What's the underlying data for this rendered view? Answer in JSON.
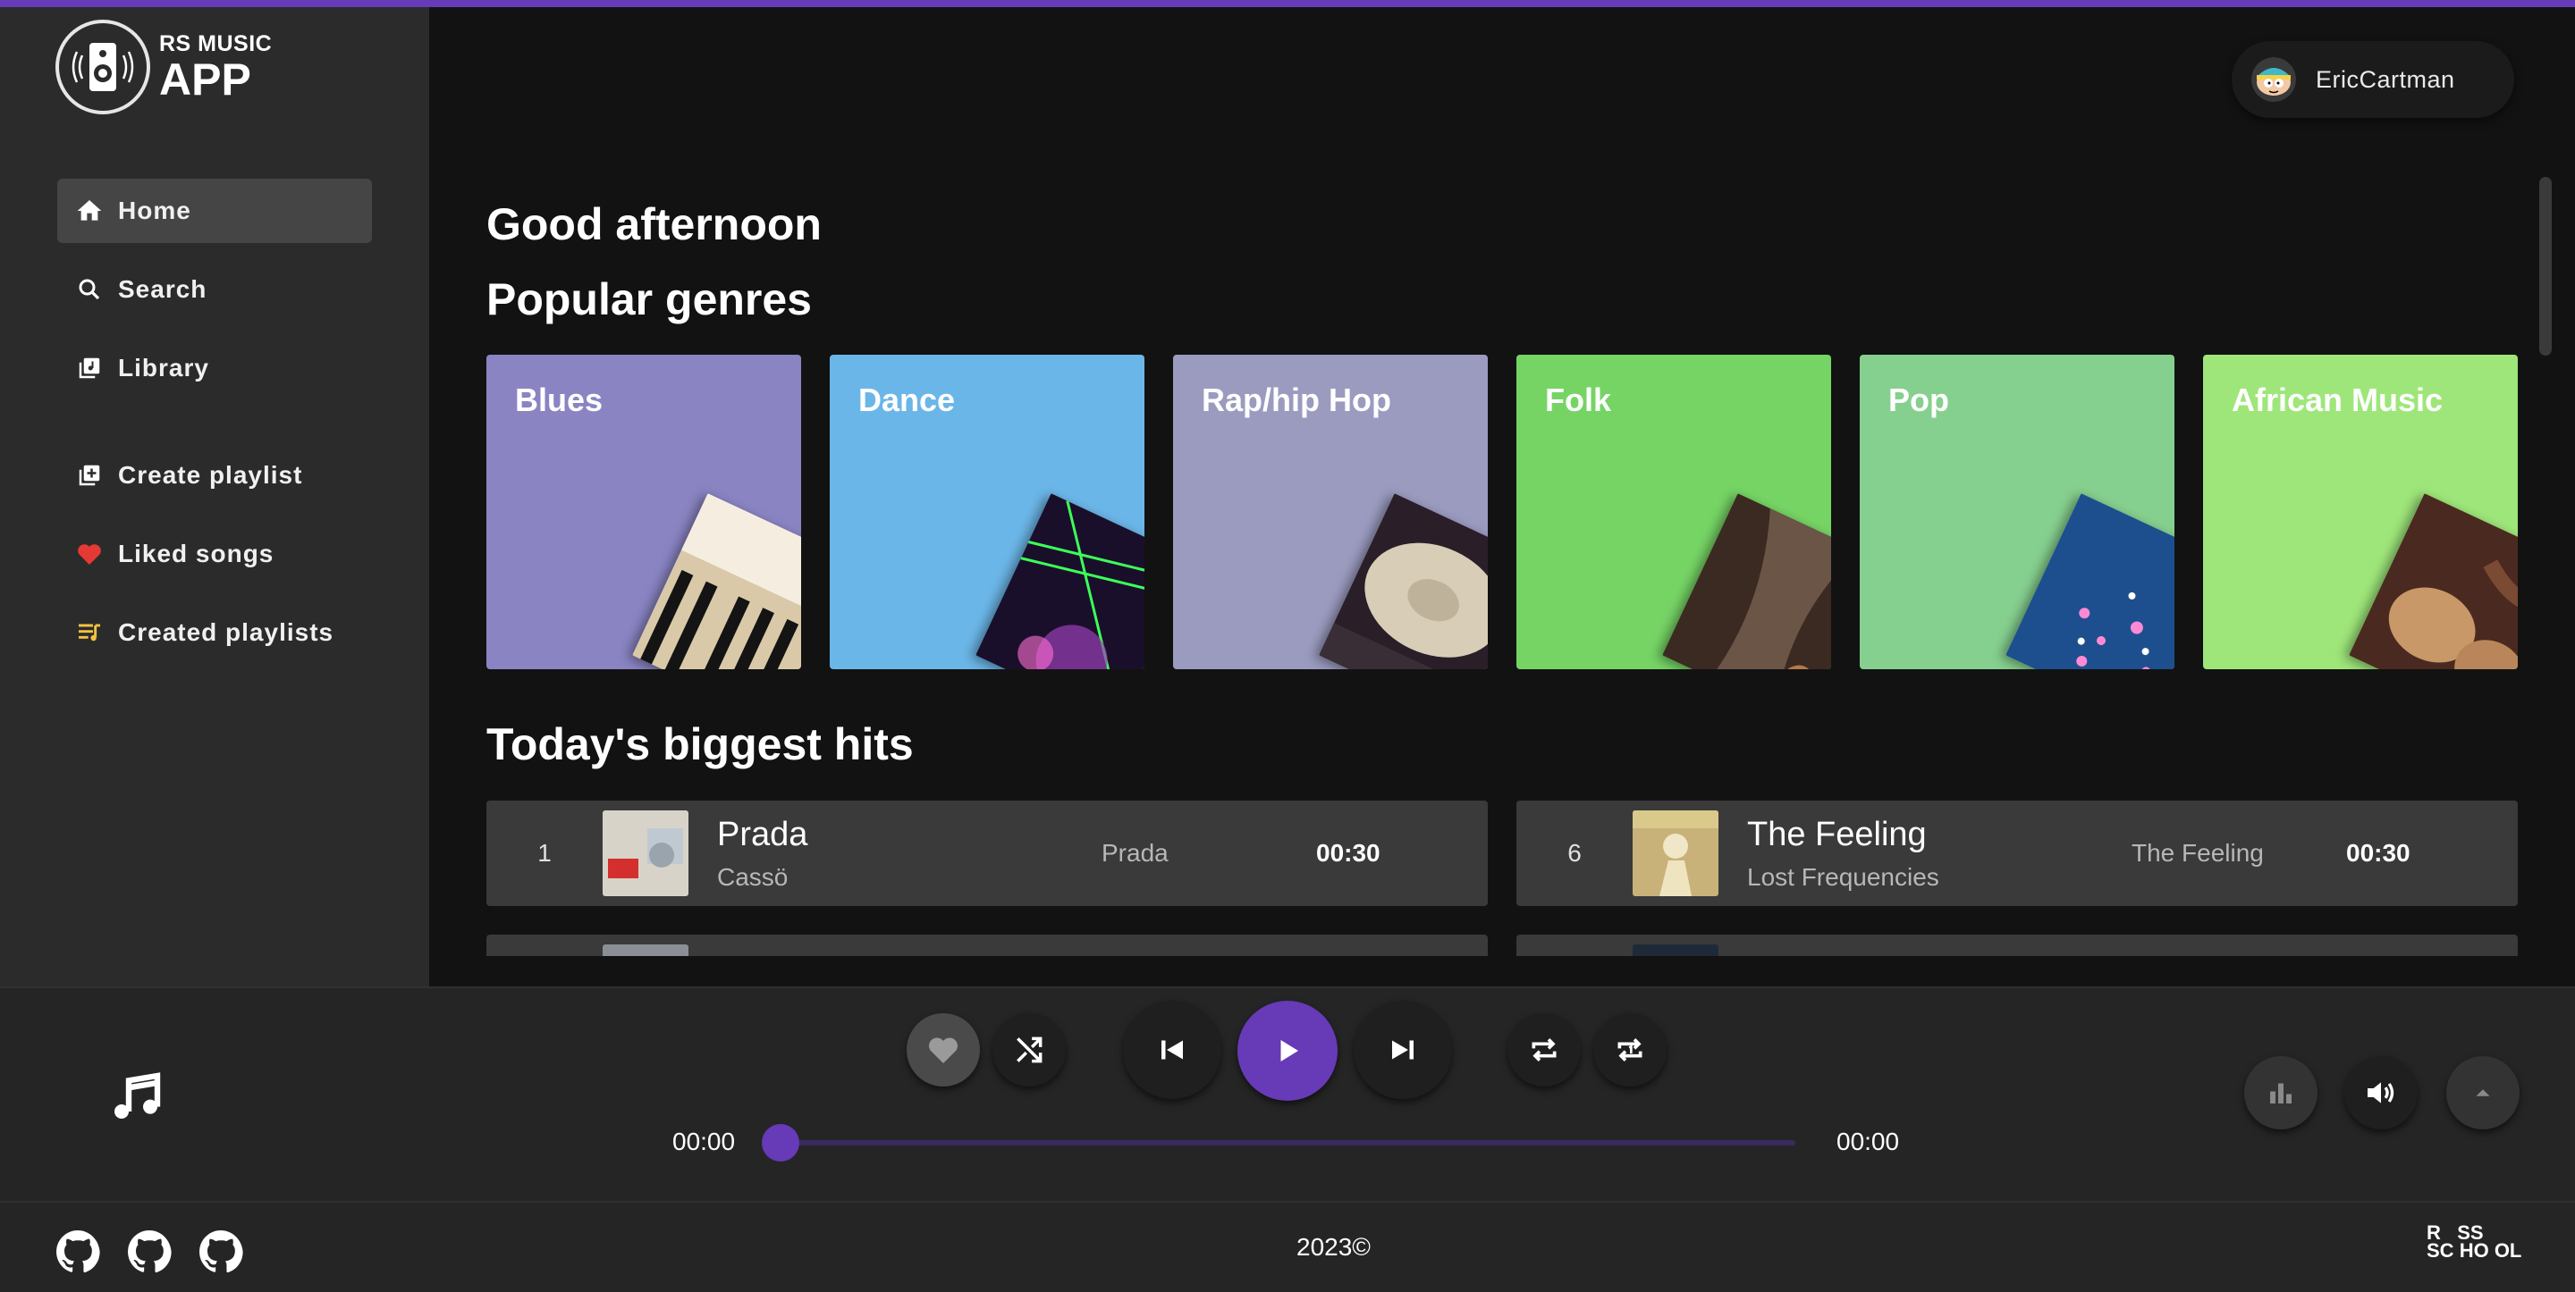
{
  "app": {
    "logo_small": "RS MUSIC",
    "logo_big": "APP"
  },
  "sidebar": {
    "items": [
      {
        "label": "Home",
        "icon": "home-icon"
      },
      {
        "label": "Search",
        "icon": "search-icon"
      },
      {
        "label": "Library",
        "icon": "library-icon"
      },
      {
        "label": "Create playlist",
        "icon": "add-playlist-icon"
      },
      {
        "label": "Liked songs",
        "icon": "heart-icon"
      },
      {
        "label": "Created playlists",
        "icon": "playlist-icon"
      }
    ],
    "active": "Home"
  },
  "header": {
    "user_name": "EricCartman"
  },
  "main": {
    "greeting": "Good afternoon",
    "genres_title": "Popular genres",
    "genres": [
      {
        "name": "Blues",
        "color": "#8a84c3"
      },
      {
        "name": "Dance",
        "color": "#6bb6e8"
      },
      {
        "name": "Rap/hip Hop",
        "color": "#9b9bc0"
      },
      {
        "name": "Folk",
        "color": "#76d465"
      },
      {
        "name": "Pop",
        "color": "#86d08f"
      },
      {
        "name": "African Music",
        "color": "#9ee67a"
      }
    ],
    "hits_title": "Today's biggest hits",
    "hits": [
      {
        "num": "1",
        "title": "Prada",
        "artist": "Cassö",
        "album": "Prada",
        "duration": "00:30"
      },
      {
        "num": "6",
        "title": "The Feeling",
        "artist": "Lost Frequencies",
        "album": "The Feeling",
        "duration": "00:30"
      }
    ]
  },
  "player": {
    "time_current": "00:00",
    "time_total": "00:00",
    "progress": 0,
    "accent": "#673ab7"
  },
  "footer": {
    "copyright": "2023©",
    "school_logo_text": [
      "R",
      "SS",
      "SC",
      "HO",
      "OL"
    ]
  }
}
